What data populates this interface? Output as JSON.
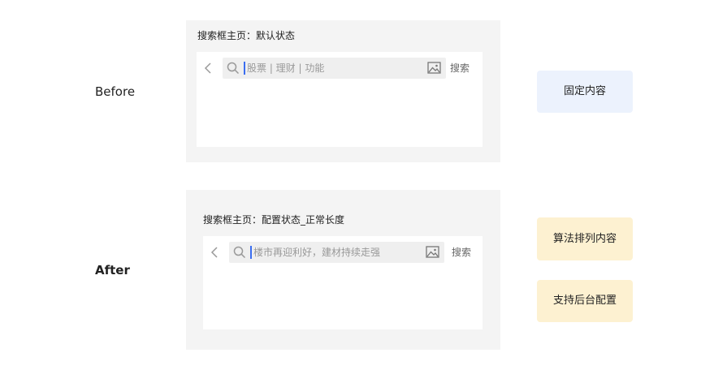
{
  "before": {
    "row_label": "Before",
    "panel_title": "搜索框主页：默认状态",
    "search": {
      "placeholder": "股票 | 理财 | 功能",
      "button_label": "搜索"
    },
    "tag": "固定内容"
  },
  "after": {
    "row_label": "After",
    "panel_title": "搜索框主页：配置状态_正常长度",
    "search": {
      "placeholder": "楼市再迎利好，建材持续走强",
      "button_label": "搜索"
    },
    "tags": [
      "算法排列内容",
      "支持后台配置"
    ]
  },
  "icons": {
    "back": "chevron-left-icon",
    "search": "search-icon",
    "image": "image-icon"
  },
  "colors": {
    "panel_bg": "#f4f4f4",
    "card_bg": "#ffffff",
    "search_bg": "#efefef",
    "caret": "#3a6df0",
    "tag_blue": "#ecf2fd",
    "tag_yellow": "#fdf1d1"
  }
}
